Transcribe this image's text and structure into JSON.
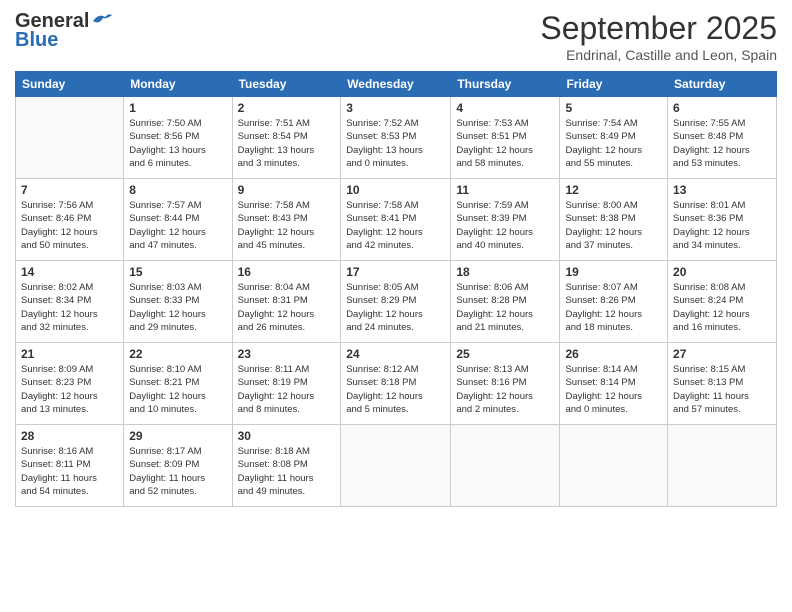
{
  "header": {
    "logo_line1": "General",
    "logo_line2": "Blue",
    "month": "September 2025",
    "location": "Endrinal, Castille and Leon, Spain"
  },
  "weekdays": [
    "Sunday",
    "Monday",
    "Tuesday",
    "Wednesday",
    "Thursday",
    "Friday",
    "Saturday"
  ],
  "weeks": [
    [
      {
        "day": "",
        "info": ""
      },
      {
        "day": "1",
        "info": "Sunrise: 7:50 AM\nSunset: 8:56 PM\nDaylight: 13 hours\nand 6 minutes."
      },
      {
        "day": "2",
        "info": "Sunrise: 7:51 AM\nSunset: 8:54 PM\nDaylight: 13 hours\nand 3 minutes."
      },
      {
        "day": "3",
        "info": "Sunrise: 7:52 AM\nSunset: 8:53 PM\nDaylight: 13 hours\nand 0 minutes."
      },
      {
        "day": "4",
        "info": "Sunrise: 7:53 AM\nSunset: 8:51 PM\nDaylight: 12 hours\nand 58 minutes."
      },
      {
        "day": "5",
        "info": "Sunrise: 7:54 AM\nSunset: 8:49 PM\nDaylight: 12 hours\nand 55 minutes."
      },
      {
        "day": "6",
        "info": "Sunrise: 7:55 AM\nSunset: 8:48 PM\nDaylight: 12 hours\nand 53 minutes."
      }
    ],
    [
      {
        "day": "7",
        "info": "Sunrise: 7:56 AM\nSunset: 8:46 PM\nDaylight: 12 hours\nand 50 minutes."
      },
      {
        "day": "8",
        "info": "Sunrise: 7:57 AM\nSunset: 8:44 PM\nDaylight: 12 hours\nand 47 minutes."
      },
      {
        "day": "9",
        "info": "Sunrise: 7:58 AM\nSunset: 8:43 PM\nDaylight: 12 hours\nand 45 minutes."
      },
      {
        "day": "10",
        "info": "Sunrise: 7:58 AM\nSunset: 8:41 PM\nDaylight: 12 hours\nand 42 minutes."
      },
      {
        "day": "11",
        "info": "Sunrise: 7:59 AM\nSunset: 8:39 PM\nDaylight: 12 hours\nand 40 minutes."
      },
      {
        "day": "12",
        "info": "Sunrise: 8:00 AM\nSunset: 8:38 PM\nDaylight: 12 hours\nand 37 minutes."
      },
      {
        "day": "13",
        "info": "Sunrise: 8:01 AM\nSunset: 8:36 PM\nDaylight: 12 hours\nand 34 minutes."
      }
    ],
    [
      {
        "day": "14",
        "info": "Sunrise: 8:02 AM\nSunset: 8:34 PM\nDaylight: 12 hours\nand 32 minutes."
      },
      {
        "day": "15",
        "info": "Sunrise: 8:03 AM\nSunset: 8:33 PM\nDaylight: 12 hours\nand 29 minutes."
      },
      {
        "day": "16",
        "info": "Sunrise: 8:04 AM\nSunset: 8:31 PM\nDaylight: 12 hours\nand 26 minutes."
      },
      {
        "day": "17",
        "info": "Sunrise: 8:05 AM\nSunset: 8:29 PM\nDaylight: 12 hours\nand 24 minutes."
      },
      {
        "day": "18",
        "info": "Sunrise: 8:06 AM\nSunset: 8:28 PM\nDaylight: 12 hours\nand 21 minutes."
      },
      {
        "day": "19",
        "info": "Sunrise: 8:07 AM\nSunset: 8:26 PM\nDaylight: 12 hours\nand 18 minutes."
      },
      {
        "day": "20",
        "info": "Sunrise: 8:08 AM\nSunset: 8:24 PM\nDaylight: 12 hours\nand 16 minutes."
      }
    ],
    [
      {
        "day": "21",
        "info": "Sunrise: 8:09 AM\nSunset: 8:23 PM\nDaylight: 12 hours\nand 13 minutes."
      },
      {
        "day": "22",
        "info": "Sunrise: 8:10 AM\nSunset: 8:21 PM\nDaylight: 12 hours\nand 10 minutes."
      },
      {
        "day": "23",
        "info": "Sunrise: 8:11 AM\nSunset: 8:19 PM\nDaylight: 12 hours\nand 8 minutes."
      },
      {
        "day": "24",
        "info": "Sunrise: 8:12 AM\nSunset: 8:18 PM\nDaylight: 12 hours\nand 5 minutes."
      },
      {
        "day": "25",
        "info": "Sunrise: 8:13 AM\nSunset: 8:16 PM\nDaylight: 12 hours\nand 2 minutes."
      },
      {
        "day": "26",
        "info": "Sunrise: 8:14 AM\nSunset: 8:14 PM\nDaylight: 12 hours\nand 0 minutes."
      },
      {
        "day": "27",
        "info": "Sunrise: 8:15 AM\nSunset: 8:13 PM\nDaylight: 11 hours\nand 57 minutes."
      }
    ],
    [
      {
        "day": "28",
        "info": "Sunrise: 8:16 AM\nSunset: 8:11 PM\nDaylight: 11 hours\nand 54 minutes."
      },
      {
        "day": "29",
        "info": "Sunrise: 8:17 AM\nSunset: 8:09 PM\nDaylight: 11 hours\nand 52 minutes."
      },
      {
        "day": "30",
        "info": "Sunrise: 8:18 AM\nSunset: 8:08 PM\nDaylight: 11 hours\nand 49 minutes."
      },
      {
        "day": "",
        "info": ""
      },
      {
        "day": "",
        "info": ""
      },
      {
        "day": "",
        "info": ""
      },
      {
        "day": "",
        "info": ""
      }
    ]
  ]
}
